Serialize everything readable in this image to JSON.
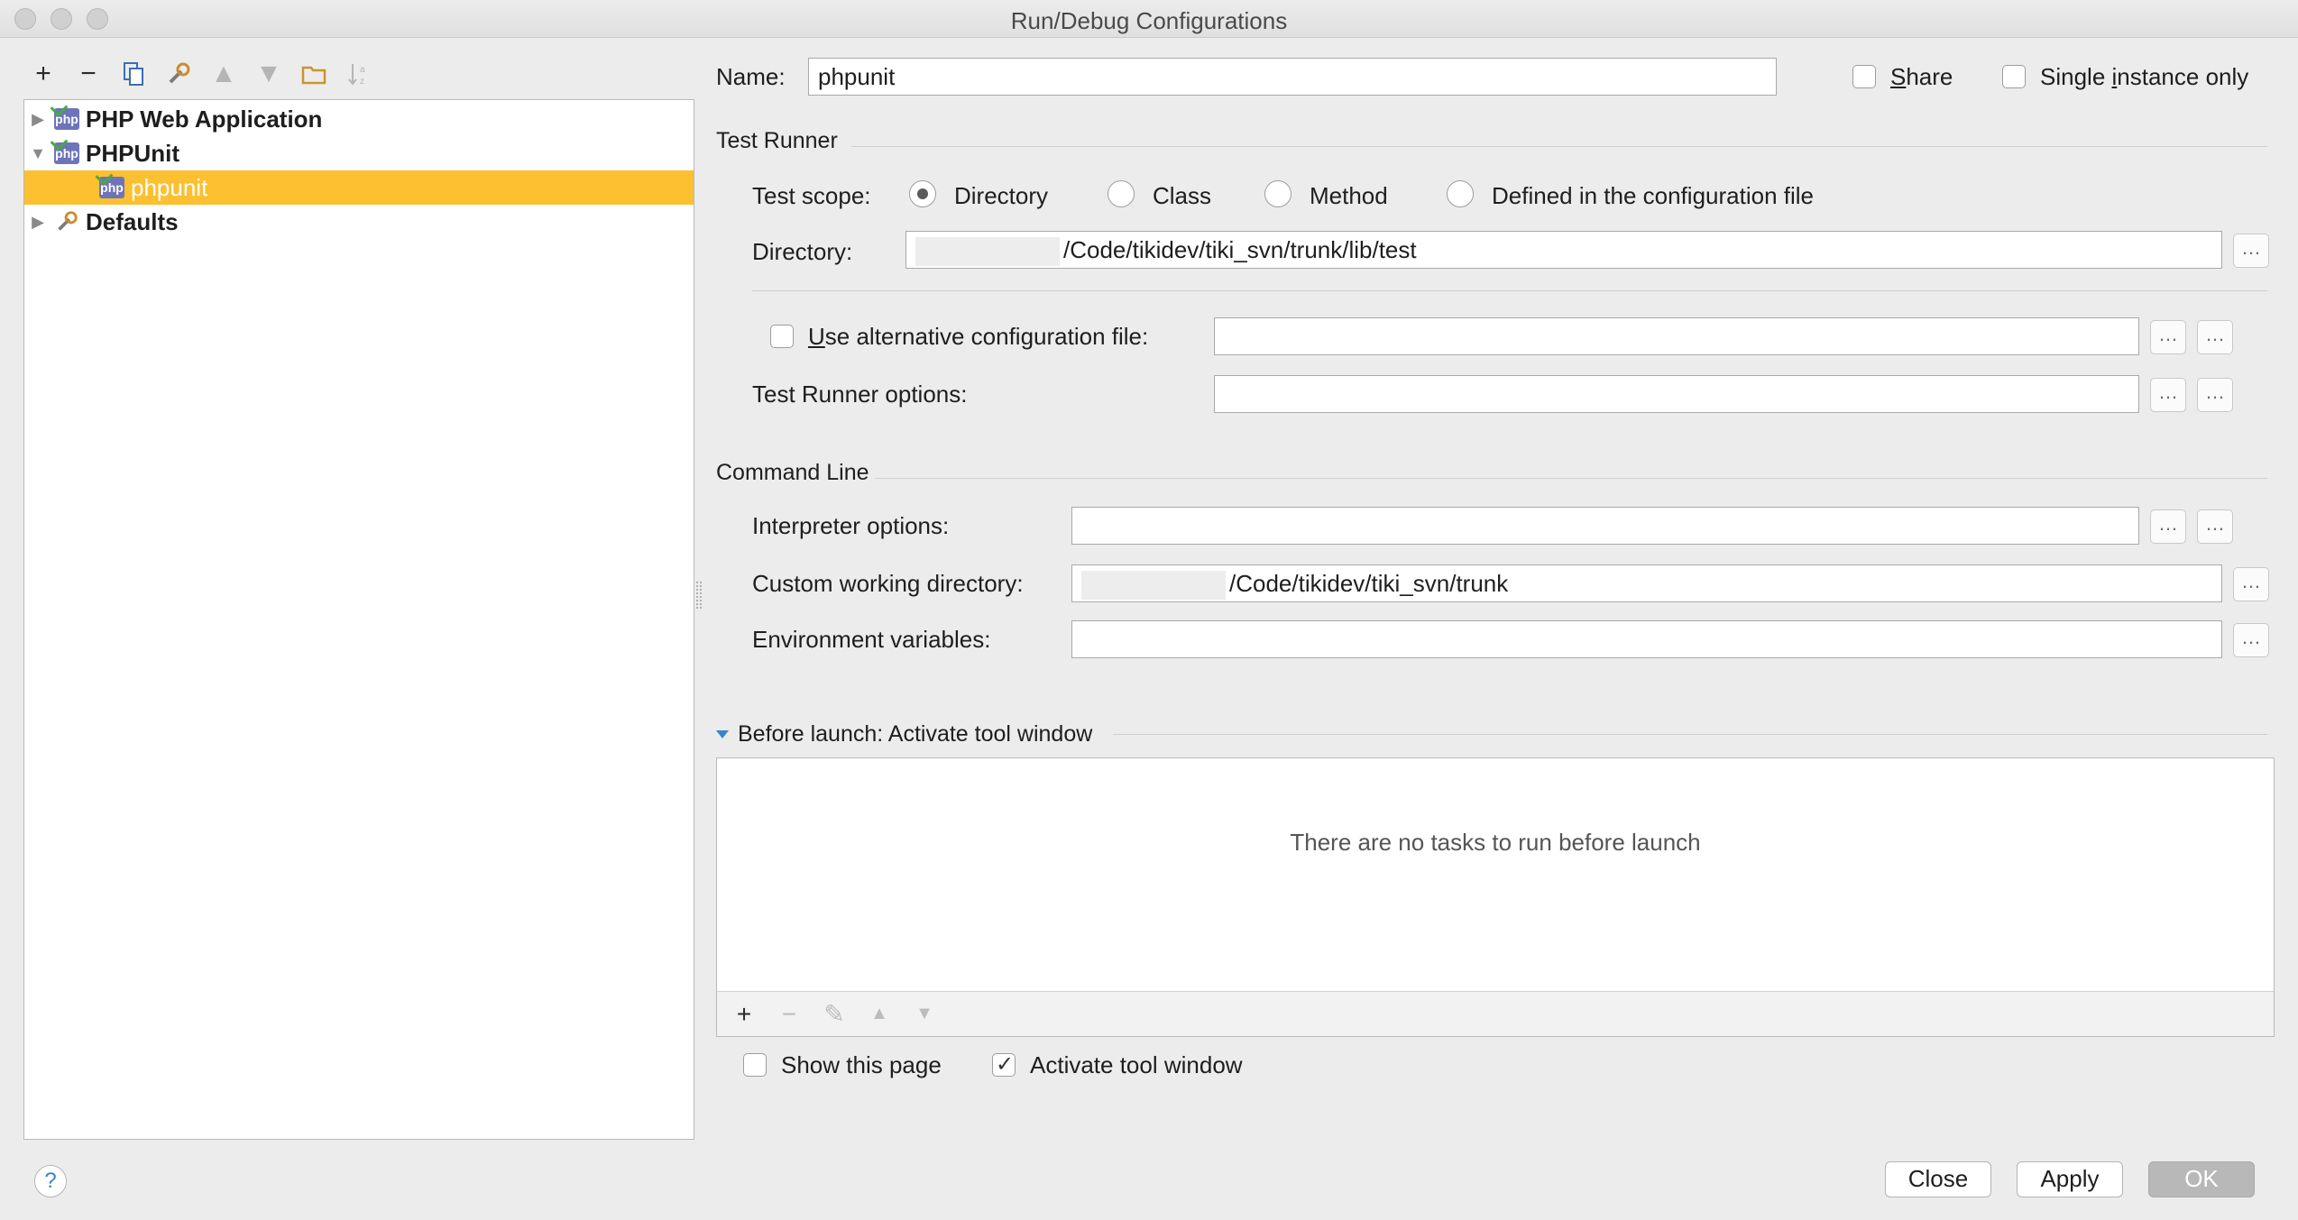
{
  "window": {
    "title": "Run/Debug Configurations"
  },
  "tree_toolbar": {
    "icons": [
      "plus-icon",
      "minus-icon",
      "copy-icon",
      "wrench-icon",
      "arrow-up-icon",
      "arrow-down-icon",
      "folder-icon",
      "sort-icon"
    ]
  },
  "tree": {
    "items": [
      {
        "label": "PHP Web Application",
        "expanded": false,
        "level": 0
      },
      {
        "label": "PHPUnit",
        "expanded": true,
        "level": 0
      },
      {
        "label": "phpunit",
        "level": 1,
        "selected": true
      },
      {
        "label": "Defaults",
        "expanded": false,
        "level": 0
      }
    ]
  },
  "config": {
    "name_label": "Name:",
    "name_value": "phpunit",
    "share_label": "Share",
    "share_checked": false,
    "single_instance_label": "Single instance only",
    "single_instance_checked": false
  },
  "test_runner": {
    "section_title": "Test Runner",
    "scope_label": "Test scope:",
    "scope_options": [
      "Directory",
      "Class",
      "Method",
      "Defined in the configuration file"
    ],
    "scope_selected": "Directory",
    "directory_label": "Directory:",
    "directory_value": "/Code/tikidev/tiki_svn/trunk/lib/test",
    "alt_config_label": "Use alternative configuration file:",
    "alt_config_checked": false,
    "alt_config_value": "",
    "options_label": "Test Runner options:",
    "options_value": ""
  },
  "command_line": {
    "section_title": "Command Line",
    "interpreter_label": "Interpreter options:",
    "interpreter_value": "",
    "working_dir_label": "Custom working directory:",
    "working_dir_value": "/Code/tikidev/tiki_svn/trunk",
    "env_label": "Environment variables:",
    "env_value": ""
  },
  "before_launch": {
    "title": "Before launch: Activate tool window",
    "empty_text": "There are no tasks to run before launch",
    "show_page_label": "Show this page",
    "show_page_checked": false,
    "activate_label": "Activate tool window",
    "activate_checked": true
  },
  "buttons": {
    "help": "?",
    "close": "Close",
    "apply": "Apply",
    "ok": "OK"
  },
  "ellipsis": "…"
}
